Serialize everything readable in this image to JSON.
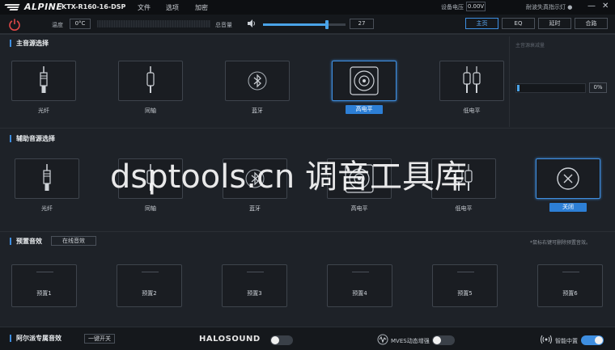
{
  "topbar": {
    "brand": "ALPINE",
    "model": "KTX-R160-16-DSP",
    "menus": [
      "文件",
      "选项",
      "加密"
    ],
    "device_voltage_label": "设备电压",
    "device_voltage": "0.00V",
    "trouble_light": "耐波失真指示灯 ●",
    "window_buttons": [
      "—",
      "✕"
    ]
  },
  "controlbar": {
    "temp_label": "温度",
    "temp_value": "0°C",
    "volume_label": "总音量",
    "volume_value": "27",
    "volume_level_pct": 77,
    "nav_tabs": [
      "主页",
      "EQ",
      "延时",
      "合路"
    ],
    "active_tab": "主页"
  },
  "main_source": {
    "title": "主音源选择",
    "items": [
      {
        "label": "光纤",
        "icon": "optical-cable-icon",
        "selected": false
      },
      {
        "label": "同轴",
        "icon": "coaxial-cable-icon",
        "selected": false
      },
      {
        "label": "蓝牙",
        "icon": "bluetooth-icon",
        "selected": false
      },
      {
        "label": "高电平",
        "icon": "speaker-icon",
        "selected": true
      },
      {
        "label": "低电平",
        "icon": "rca-cable-icon",
        "selected": false
      }
    ],
    "attenuation_label": "主音源衰减量",
    "attenuation_value": "0%"
  },
  "aux_source": {
    "title": "辅助音源选择",
    "items": [
      {
        "label": "光纤",
        "icon": "optical-cable-icon",
        "selected": false
      },
      {
        "label": "同轴",
        "icon": "coaxial-cable-icon",
        "selected": false
      },
      {
        "label": "蓝牙",
        "icon": "bluetooth-icon",
        "selected": false
      },
      {
        "label": "高电平",
        "icon": "speaker-icon",
        "selected": false
      },
      {
        "label": "低电平",
        "icon": "rca-cable-icon",
        "selected": false
      },
      {
        "label": "关闭",
        "icon": "close-circle-icon",
        "selected": true
      }
    ]
  },
  "presets": {
    "title": "预置音效",
    "online_button": "在线音效",
    "hint": "*鼠标右键可删除预置音效。",
    "items": [
      "预置1",
      "预置2",
      "预置3",
      "预置4",
      "预置5",
      "预置6"
    ]
  },
  "bottom": {
    "title": "阿尔派专属音效",
    "one_key_button": "一键开关",
    "halosound_label": "HALOSOUND",
    "halosound_on": false,
    "mves_label": "MVES动态增强",
    "mves_on": false,
    "smart_center_label": "智能中置",
    "smart_center_on": true
  },
  "watermark": "dsptools.cn 调音工具库",
  "colors": {
    "accent": "#3e8ee0",
    "background": "#1b1f24",
    "power": "#e04848"
  }
}
